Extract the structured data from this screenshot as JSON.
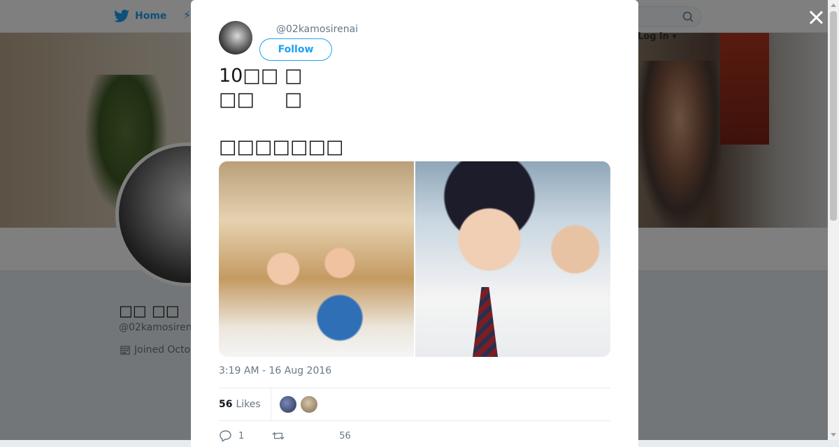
{
  "nav": {
    "home_label": "Home",
    "login_label": "Log in"
  },
  "profile": {
    "display_name": "□□ □□",
    "handle": "@02kamosiren",
    "joined": "Joined Octo"
  },
  "tweet": {
    "handle": "@02kamosirenai",
    "follow_label": "Follow",
    "text": "10□□ □\n□□     □\n\n□□□□□□□",
    "timestamp": "3:19 AM - 16 Aug 2016",
    "likes_count": "56",
    "likes_label": "Likes",
    "reply_count": "1",
    "retweet_count": "",
    "like_action_count": "56"
  },
  "colors": {
    "accent": "#1da1f2",
    "overlay": "rgba(0,0,0,0.5)"
  }
}
